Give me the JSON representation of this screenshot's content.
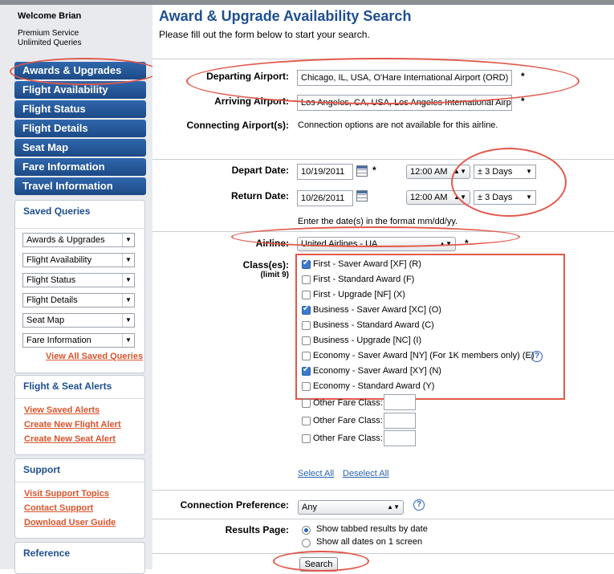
{
  "user": {
    "welcome": "Welcome Brian",
    "service": "Premium Service",
    "queries": "Unlimited Queries"
  },
  "nav": [
    "Awards & Upgrades",
    "Flight Availability",
    "Flight Status",
    "Flight Details",
    "Seat Map",
    "Fare Information",
    "Travel Information"
  ],
  "saved": {
    "title": "Saved Queries",
    "items": [
      "Awards & Upgrades",
      "Flight Availability",
      "Flight Status",
      "Flight Details",
      "Seat Map",
      "Fare Information"
    ],
    "view_all": "View All Saved Queries"
  },
  "alerts": {
    "title": "Flight & Seat Alerts",
    "links": [
      "View Saved Alerts",
      "Create New Flight Alert",
      "Create New Seat Alert"
    ]
  },
  "support": {
    "title": "Support",
    "links": [
      "Visit Support Topics",
      "Contact Support",
      "Download User Guide"
    ]
  },
  "reference": {
    "title": "Reference"
  },
  "page": {
    "title": "Award & Upgrade Availability Search",
    "intro": "Please fill out the form below to start your search."
  },
  "form": {
    "departing_label": "Departing Airport:",
    "departing_value": "Chicago, IL, USA, O'Hare International Airport (ORD)",
    "arriving_label": "Arriving Airport:",
    "arriving_value": "Los Angeles, CA, USA, Los Angeles International Airpo",
    "connecting_label": "Connecting Airport(s):",
    "connecting_note": "Connection options are not available for this airline.",
    "depart_label": "Depart Date:",
    "depart_date": "10/19/2011",
    "depart_time": "12:00 AM",
    "depart_range": "± 3 Days",
    "return_label": "Return Date:",
    "return_date": "10/26/2011",
    "return_time": "12:00 AM",
    "return_range": "± 3 Days",
    "date_note": "Enter the date(s) in the format mm/dd/yy.",
    "airline_label": "Airline:",
    "airline_value": "United Airlines - UA",
    "required_mark": "*",
    "classes_label": "Class(es):",
    "classes_limit": "(limit 9)",
    "classes": [
      {
        "label": "First - Saver Award [XF] (R)",
        "checked": true
      },
      {
        "label": "First - Standard Award (F)",
        "checked": false
      },
      {
        "label": "First - Upgrade [NF] (X)",
        "checked": false
      },
      {
        "label": "Business - Saver Award [XC] (O)",
        "checked": true
      },
      {
        "label": "Business - Standard Award (C)",
        "checked": false
      },
      {
        "label": "Business - Upgrade [NC] (I)",
        "checked": false
      },
      {
        "label": "Economy - Saver Award [NY] (For 1K members only) (E)",
        "checked": false
      },
      {
        "label": "Economy - Saver Award [XY] (N)",
        "checked": true
      },
      {
        "label": "Economy - Standard Award (Y)",
        "checked": false
      }
    ],
    "other_fare": "Other Fare Class:",
    "select_all": "Select All",
    "deselect_all": "Deselect All",
    "connection_label": "Connection Preference:",
    "connection_value": "Any",
    "results_label": "Results Page:",
    "results_tabbed": "Show tabbed results by date",
    "results_all": "Show all dates on 1 screen",
    "search_button": "Search"
  },
  "colors": {
    "nav_blue": "#1d4a86",
    "title_blue": "#1d4f91",
    "link_orange": "#d9532b",
    "highlight_red": "#e0584a"
  }
}
